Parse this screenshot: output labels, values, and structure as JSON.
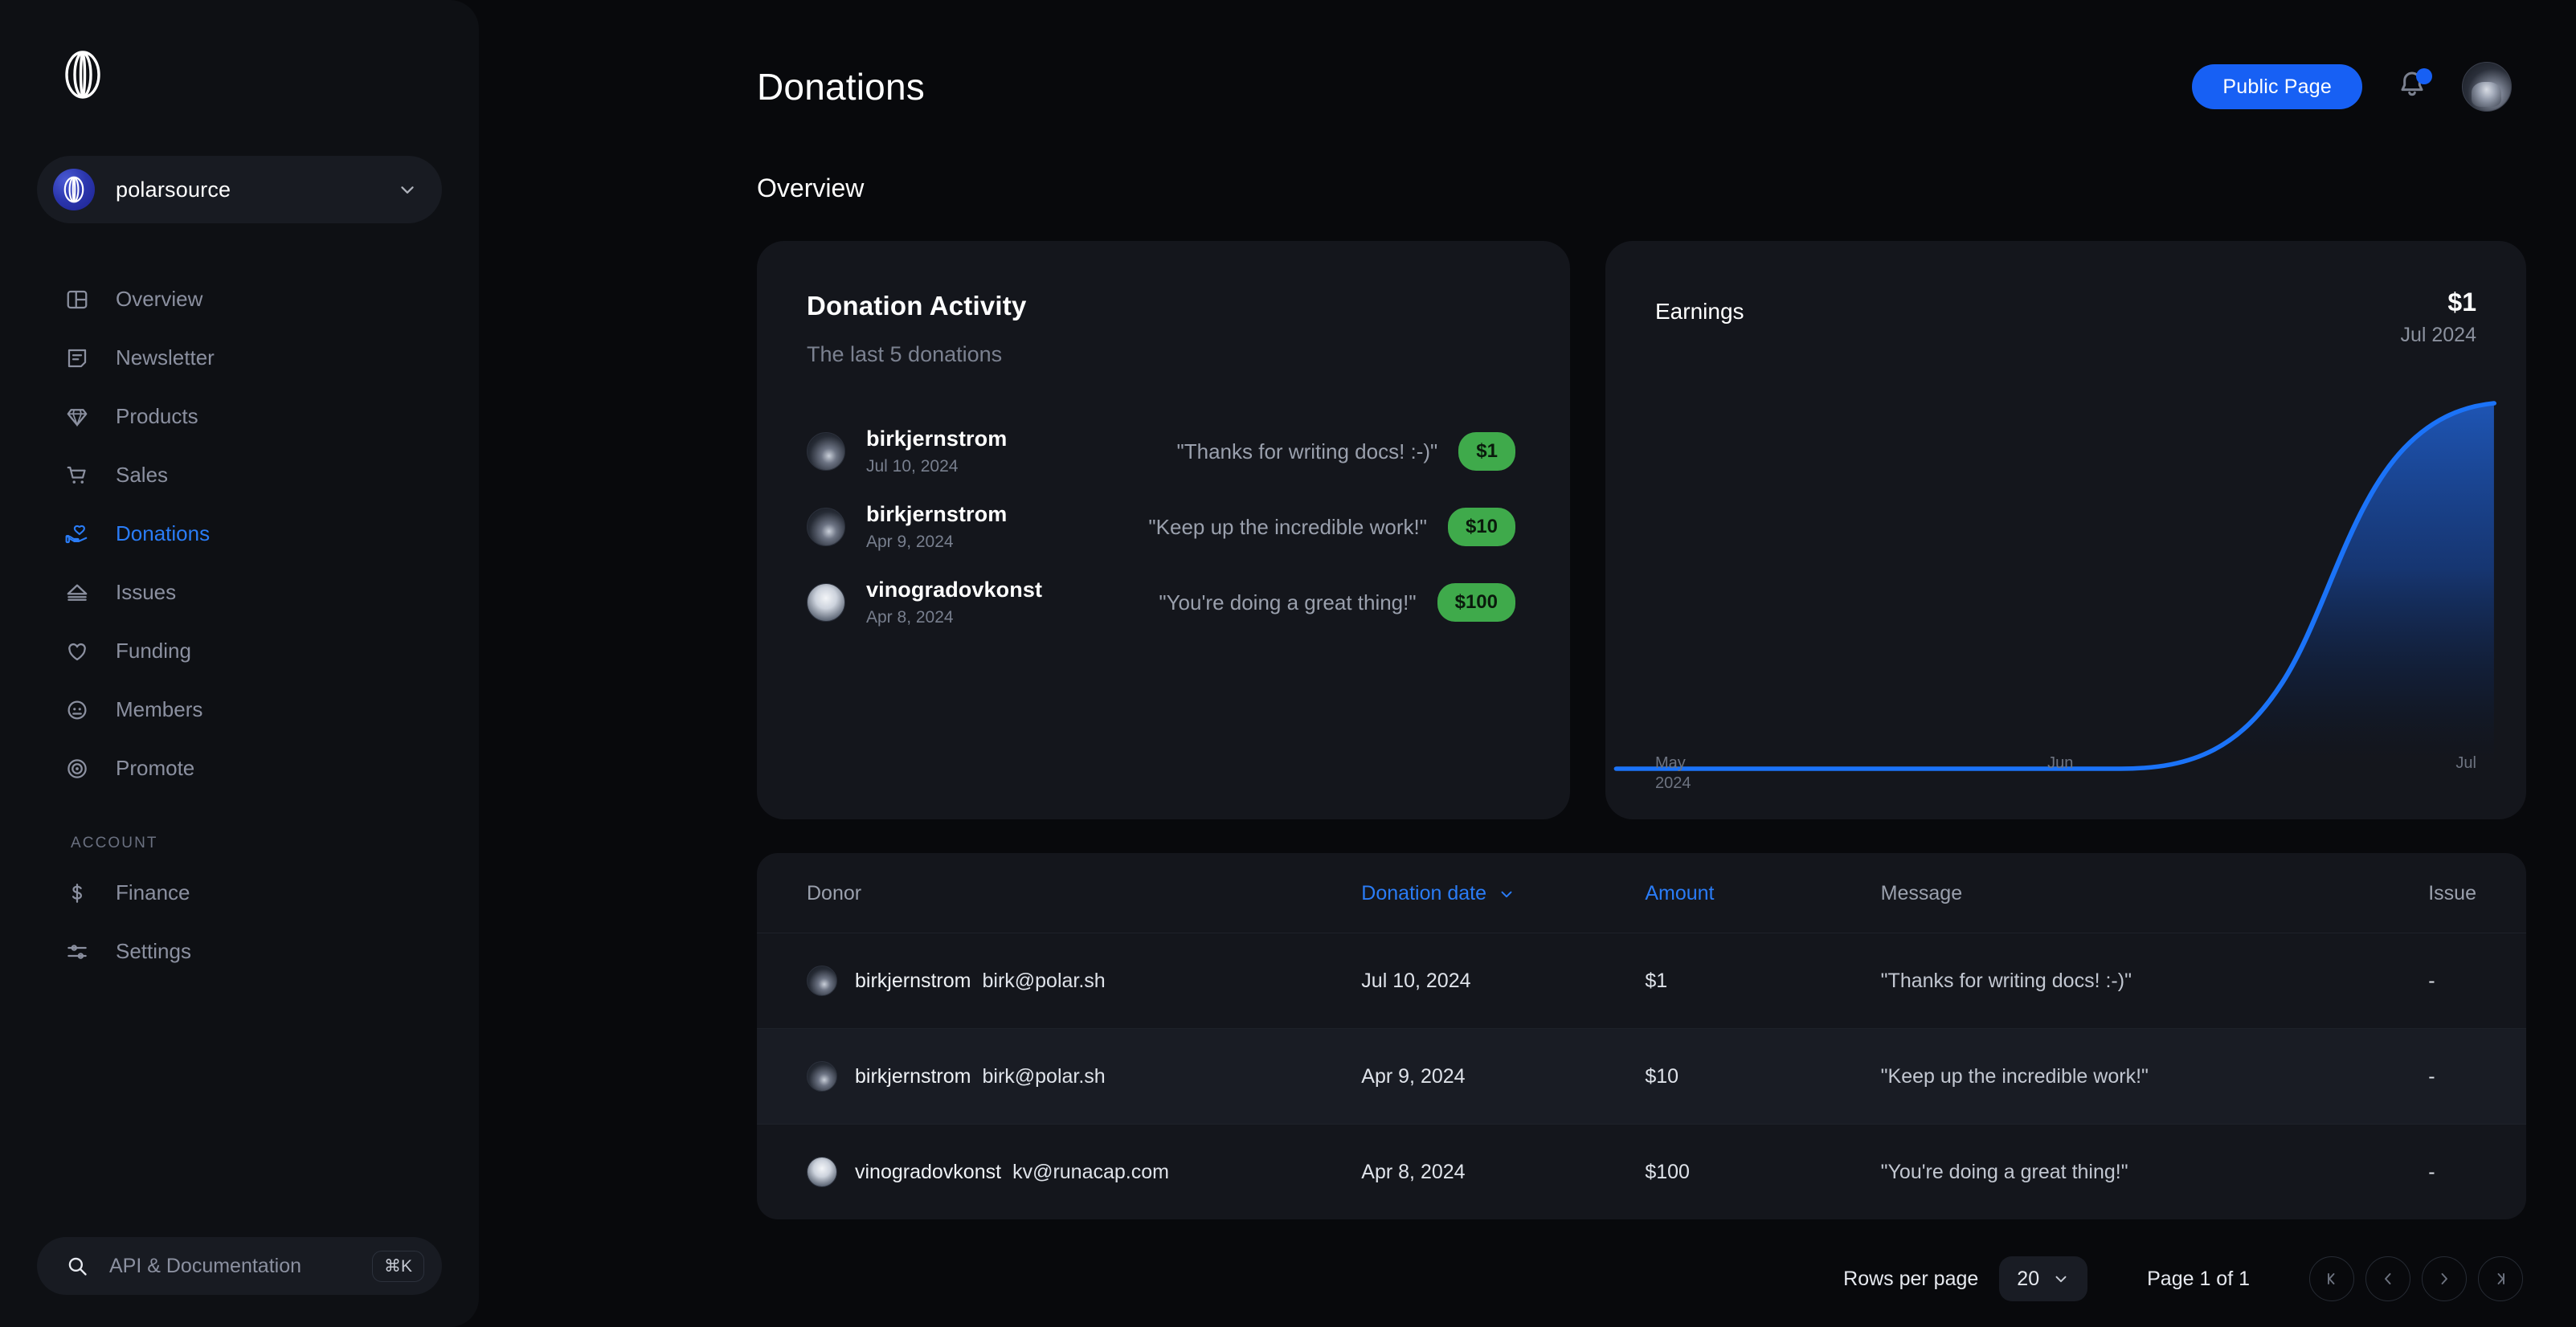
{
  "sidebar": {
    "logo_name": "polar-logo",
    "org": {
      "name": "polarsource",
      "chevron": "chevron-down-icon"
    },
    "nav": [
      {
        "label": "Overview",
        "icon": "layout-icon",
        "active": false
      },
      {
        "label": "Newsletter",
        "icon": "newsletter-icon",
        "active": false
      },
      {
        "label": "Products",
        "icon": "diamond-icon",
        "active": false
      },
      {
        "label": "Sales",
        "icon": "cart-icon",
        "active": false
      },
      {
        "label": "Donations",
        "icon": "donation-icon",
        "active": true
      },
      {
        "label": "Issues",
        "icon": "issues-icon",
        "active": false
      },
      {
        "label": "Funding",
        "icon": "heart-icon",
        "active": false
      },
      {
        "label": "Members",
        "icon": "members-icon",
        "active": false
      },
      {
        "label": "Promote",
        "icon": "promote-icon",
        "active": false
      }
    ],
    "account_section": "ACCOUNT",
    "account_nav": [
      {
        "label": "Finance",
        "icon": "dollar-icon"
      },
      {
        "label": "Settings",
        "icon": "sliders-icon"
      }
    ],
    "search": {
      "placeholder": "API & Documentation",
      "shortcut": "⌘K",
      "icon": "search-icon"
    }
  },
  "header": {
    "title": "Donations",
    "public_page_label": "Public Page",
    "bell_icon": "bell-icon",
    "has_notification": true,
    "avatar": "user-avatar"
  },
  "overview": {
    "heading": "Overview",
    "activity": {
      "title": "Donation Activity",
      "subtitle": "The last 5 donations",
      "rows": [
        {
          "name": "birkjernstrom",
          "date": "Jul 10, 2024",
          "message": "\"Thanks for writing docs! :-)\"",
          "amount": "$1",
          "avatar_tone": "dark"
        },
        {
          "name": "birkjernstrom",
          "date": "Apr 9, 2024",
          "message": "\"Keep up the incredible work!\"",
          "amount": "$10",
          "avatar_tone": "dark"
        },
        {
          "name": "vinogradovkonst",
          "date": "Apr 8, 2024",
          "message": "\"You're doing a great thing!\"",
          "amount": "$100",
          "avatar_tone": "light"
        }
      ]
    },
    "earnings": {
      "title": "Earnings",
      "amount": "$1",
      "period": "Jul 2024"
    }
  },
  "chart_data": {
    "type": "area",
    "title": "Earnings",
    "xlabel": "",
    "ylabel": "",
    "grid": false,
    "legend": "none",
    "line_color": "#1b73f8",
    "fill_color": "#1b4fa8",
    "x_tick_labels": [
      "May 2024",
      "Jun",
      "Jul"
    ],
    "x": [
      "May 2024",
      "Jun",
      "Jul"
    ],
    "series": [
      {
        "name": "Earnings",
        "values": [
          0,
          0,
          1
        ]
      }
    ],
    "annotation_value": "$1",
    "annotation_period": "Jul 2024",
    "ylim": [
      0,
      1
    ]
  },
  "table": {
    "columns": [
      {
        "key": "donor",
        "label": "Donor",
        "accent": false,
        "sortable": false
      },
      {
        "key": "date",
        "label": "Donation date",
        "accent": true,
        "sortable": true
      },
      {
        "key": "amount",
        "label": "Amount",
        "accent": true,
        "sortable": false
      },
      {
        "key": "message",
        "label": "Message",
        "accent": false,
        "sortable": false
      },
      {
        "key": "issue",
        "label": "Issue",
        "accent": false,
        "sortable": false
      }
    ],
    "sort_icon": "chevron-down-icon",
    "rows": [
      {
        "donor_user": "birkjernstrom",
        "donor_email": "birk@polar.sh",
        "date": "Jul 10, 2024",
        "amount": "$1",
        "message": "\"Thanks for writing docs! :-)\"",
        "issue": "-",
        "avatar_tone": "dark",
        "highlight": false
      },
      {
        "donor_user": "birkjernstrom",
        "donor_email": "birk@polar.sh",
        "date": "Apr 9, 2024",
        "amount": "$10",
        "message": "\"Keep up the incredible work!\"",
        "issue": "-",
        "avatar_tone": "dark",
        "highlight": true
      },
      {
        "donor_user": "vinogradovkonst",
        "donor_email": "kv@runacap.com",
        "date": "Apr 8, 2024",
        "amount": "$100",
        "message": "\"You're doing a great thing!\"",
        "issue": "-",
        "avatar_tone": "light",
        "highlight": false
      }
    ]
  },
  "pagination": {
    "rows_per_page_label": "Rows per page",
    "rows_per_page_value": "20",
    "page_label": "Page 1 of 1",
    "buttons": [
      "first-page",
      "previous-page",
      "next-page",
      "last-page"
    ]
  },
  "colors": {
    "accent_blue": "#1760f4",
    "link_blue": "#2a7cf6",
    "badge_green": "#3faa4b",
    "page_bg": "#08090c",
    "sidebar_bg": "#0e1014",
    "card_bg": "#14161c"
  }
}
